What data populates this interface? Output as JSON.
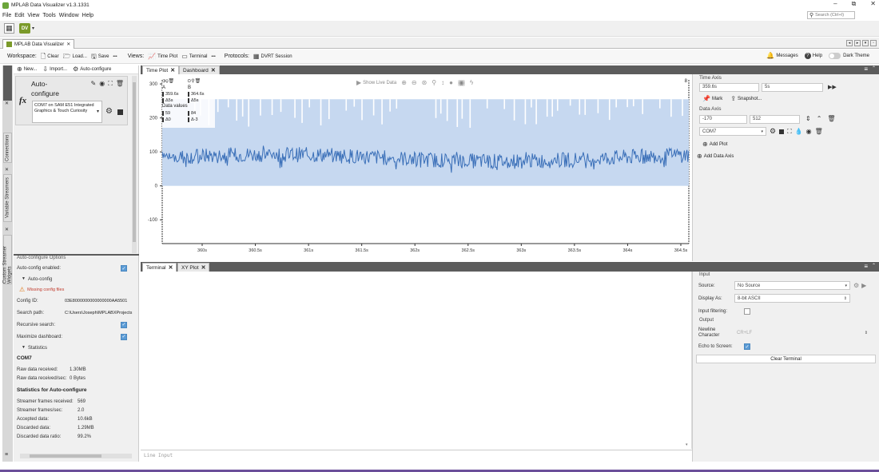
{
  "window": {
    "title": "MPLAB Data Visualizer v1.3.1331",
    "controls": [
      "–",
      "⧉",
      "✕"
    ]
  },
  "menu": [
    "File",
    "Edit",
    "View",
    "Tools",
    "Window",
    "Help"
  ],
  "search": {
    "placeholder": "Search (Ctrl+I)"
  },
  "doc_tab": {
    "label": "MPLAB Data Visualizer"
  },
  "toolbar": {
    "workspace_label": "Workspace:",
    "clear": "Clear",
    "load": "Load...",
    "save": "Save",
    "more": "•••",
    "views_label": "Views:",
    "time_plot": "Time Plot",
    "terminal": "Terminal",
    "more2": "•••",
    "protocols_label": "Protocols:",
    "dvrt": "DVRT Session",
    "messages": "Messages",
    "help": "Help",
    "dark_theme": "Dark Theme"
  },
  "side_tabs": [
    "Connections",
    "Variable Streamers",
    "Custom Streamer Widgets"
  ],
  "left": {
    "new": "New...",
    "import": "Import...",
    "auto_configure": "Auto-configure",
    "card_title": "Auto-\nconfigure",
    "device": "COM7 on SAM E51 Integrated Graphics & Touch Curiosity",
    "options_title": "Auto-configure Options",
    "enabled_label": "Auto-config enabled:",
    "autoconfig_section": "Auto-config",
    "warning": "Missing config files",
    "config_id_label": "Config ID:",
    "config_id": "03E8000000000000000AA5501",
    "search_path_label": "Search path:",
    "search_path": "C:\\Users\\Joseph\\MPLABXProjects",
    "recursive_label": "Recursive search:",
    "maximize_label": "Maximize dashboard:",
    "statistics_section": "Statistics",
    "com_title": "COM7",
    "raw_received_label": "Raw data received:",
    "raw_received": "1.30MB",
    "raw_rate_label": "Raw data received/sec:",
    "raw_rate": "0 Bytes",
    "stats_title": "Statistics for Auto-configure",
    "frames_label": "Streamer frames received:",
    "frames": "569",
    "fps_label": "Streamer frames/sec:",
    "fps": "2.0",
    "accepted_label": "Accepted data:",
    "accepted": "10.6kB",
    "discarded_label": "Discarded data:",
    "discarded": "1.29MB",
    "ratio_label": "Discarded data ratio:",
    "ratio": "99.2%"
  },
  "plot_tabs": [
    "Time Plot",
    "Dashboard"
  ],
  "plot": {
    "show_live": "Show Live Data",
    "cursor_a": "A",
    "cursor_b": "B",
    "a_time": "359.6s",
    "b_time": "364.6s",
    "delta_t": "Δ5s",
    "delta_t2": "Δ5s",
    "data_values": "Data values",
    "a_val": "59",
    "b_val": "84",
    "delta_a": "Δ0",
    "delta_b": "Δ-3",
    "page_num": "8"
  },
  "chart_data": {
    "type": "line",
    "yticks": [
      300,
      200,
      100,
      0,
      -100
    ],
    "xticks": [
      "360s",
      "360.5s",
      "361s",
      "361.5s",
      "362s",
      "362.5s",
      "363s",
      "363.5s",
      "364s",
      "364.5s"
    ],
    "ylim": [
      -170,
      312
    ],
    "series": [
      {
        "values_approx": "noisy signal ~45–110, mean ~75"
      }
    ]
  },
  "right": {
    "time_axis": "Time Axis",
    "t_start": "359.6s",
    "t_span": "5s",
    "mark": "Mark",
    "snapshot": "Snapshot...",
    "data_axis": "Data Axis",
    "d_min": "-170",
    "d_max": "512",
    "source": "COM7",
    "add_plot": "Add Plot",
    "add_axis": "Add Data Axis"
  },
  "bottom_tabs": [
    "Terminal",
    "XY Plot"
  ],
  "terminal": {
    "input_placeholder": "Line Input"
  },
  "term_right": {
    "input_title": "Input",
    "source_label": "Source:",
    "source": "No Source",
    "display_label": "Display As:",
    "display": "8-bit ASCII",
    "filtering_label": "Input filtering:",
    "output_title": "Output",
    "newline_label": "Newline Character",
    "newline": "CR+LF",
    "echo_label": "Echo to Screen:",
    "clear": "Clear Terminal"
  }
}
